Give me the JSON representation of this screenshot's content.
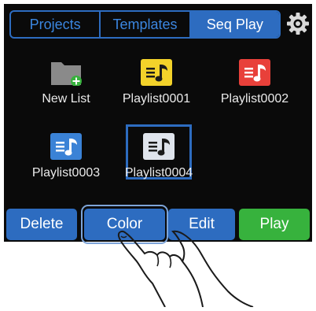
{
  "tabs": [
    {
      "label": "Projects",
      "active": false
    },
    {
      "label": "Templates",
      "active": false
    },
    {
      "label": "Seq Play",
      "active": true
    }
  ],
  "settings_icon": "gear-icon",
  "items": [
    {
      "label": "New List",
      "icon": "folder-add-icon",
      "color": "#8a8a8a"
    },
    {
      "label": "Playlist0001",
      "icon": "playlist-icon",
      "color": "#f3d22a"
    },
    {
      "label": "Playlist0002",
      "icon": "playlist-icon",
      "color": "#e8403a"
    },
    {
      "label": "Playlist0003",
      "icon": "playlist-icon",
      "color": "#3a82d6"
    },
    {
      "label": "Playlist0004",
      "icon": "playlist-icon",
      "color": "#dfe4ec",
      "selected": true
    }
  ],
  "buttons": {
    "delete": "Delete",
    "color": "Color",
    "edit": "Edit",
    "play": "Play"
  },
  "colors": {
    "accent_blue": "#2d6cc0",
    "play_green": "#37b23d",
    "background": "#0a0a0a"
  }
}
